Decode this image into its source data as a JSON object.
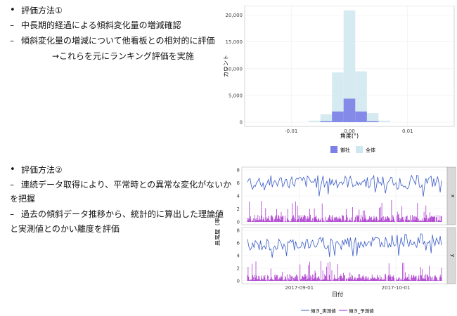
{
  "slide": {
    "section1": {
      "heading": "評価方法①",
      "line1": "中長期的経過による傾斜変化量の増減確認",
      "line2": "傾斜変化量の増減について他看板との相対的に評価",
      "line3": "→これらを元にランキング評価を実施"
    },
    "section2": {
      "heading": "評価方法②",
      "line1a": "連続データ取得により、平常時との異常な変化がないか",
      "line1b": "を把握",
      "line2a": "過去の傾斜データ推移から、統計的に算出した理論値",
      "line2b": "と実測値とのかい離度を評価"
    },
    "symbols": {
      "bullet": "•",
      "dash": "–"
    }
  },
  "chart_data": [
    {
      "type": "bar",
      "xlabel": "角度(°)",
      "ylabel": "カウント",
      "xlim": [
        -0.018,
        0.018
      ],
      "ylim": [
        0,
        21000
      ],
      "x_ticks": [
        "-0.01",
        "0.00",
        "0.01"
      ],
      "y_ticks": [
        "0",
        "5,000",
        "10,000",
        "15,000",
        "20,000"
      ],
      "bin_width": 0.002,
      "series": [
        {
          "name": "御社",
          "color": "#7b7fe6",
          "bins": [
            [
              -0.004,
              200
            ],
            [
              -0.002,
              2000
            ],
            [
              0.0,
              4400
            ],
            [
              0.002,
              2000
            ],
            [
              0.004,
              200
            ]
          ]
        },
        {
          "name": "全体",
          "color": "#cfe8ef",
          "bins": [
            [
              -0.006,
              300
            ],
            [
              -0.004,
              1500
            ],
            [
              -0.002,
              9300
            ],
            [
              0.0,
              20900
            ],
            [
              0.002,
              9500
            ],
            [
              0.004,
              1700
            ],
            [
              0.006,
              300
            ]
          ]
        }
      ],
      "legend_position": "bottom",
      "grid": true
    },
    {
      "type": "line",
      "xlabel": "日付",
      "ylabel": "異常度（率）",
      "x_ticks": [
        "2017-09-01",
        "2017-10-01"
      ],
      "y_ticks": [
        "0",
        "2",
        "4",
        "6",
        "8"
      ],
      "ylim": [
        0,
        8
      ],
      "facets": [
        "x",
        "y"
      ],
      "series": [
        {
          "name": "傾き_実測値",
          "color": "#3a5bc7"
        },
        {
          "name": "傾き_予測値",
          "color": "#a020c8"
        }
      ],
      "legend_position": "bottom",
      "grid": true
    }
  ]
}
